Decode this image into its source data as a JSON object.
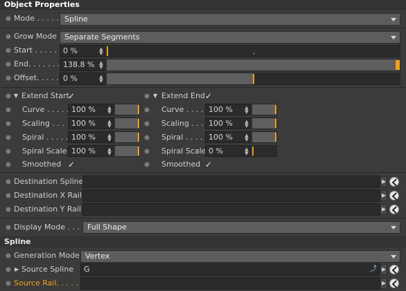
{
  "header": {
    "title": "Object Properties"
  },
  "mode": {
    "label": "Mode . . . . .",
    "value": "Spline"
  },
  "grow_mode": {
    "label": "Grow Mode",
    "value": "Separate Segments"
  },
  "start": {
    "label": "Start . . . . . .",
    "value": "0 %",
    "level": 0
  },
  "end": {
    "label": "End. . . . . . .",
    "value": "138.8 %",
    "level": 1.0
  },
  "offset": {
    "label": "Offset. . . . .",
    "value": "0 %",
    "level": 0.5
  },
  "extend_start": {
    "label": "Extend Start",
    "check": "✓"
  },
  "extend_end": {
    "label": "Extend End",
    "check": "✓"
  },
  "left_group": {
    "curve": {
      "label": "Curve . . . . .",
      "value": "100 %",
      "level": 1.0
    },
    "scaling": {
      "label": "Scaling . . . .",
      "value": "100 %",
      "level": 1.0
    },
    "spiral": {
      "label": "Spiral . . . . .",
      "value": "100 %",
      "level": 1.0
    },
    "spiral_scale": {
      "label": "Spiral Scale",
      "value": "100 %",
      "level": 1.0
    },
    "smoothed": {
      "label": "Smoothed",
      "check": "✓"
    }
  },
  "right_group": {
    "curve": {
      "label": "Curve . . . . .",
      "value": "100 %",
      "level": 1.0
    },
    "scaling": {
      "label": "Scaling . . . .",
      "value": "100 %",
      "level": 1.0
    },
    "spiral": {
      "label": "Spiral . . . . .",
      "value": "100 %",
      "level": 1.0
    },
    "spiral_scale": {
      "label": "Spiral Scale",
      "value": "0 %",
      "level": 0
    },
    "smoothed": {
      "label": "Smoothed",
      "check": "✓"
    }
  },
  "destination_spline": {
    "label": "Destination Spline",
    "value": ""
  },
  "destination_x_rail": {
    "label": "Destination X Rail",
    "value": ""
  },
  "destination_y_rail": {
    "label": "Destination Y Rail",
    "value": ""
  },
  "display_mode": {
    "label": "Display Mode . . .",
    "value": "Full Shape"
  },
  "spline_section": {
    "title": "Spline"
  },
  "generation_mode": {
    "label": "Generation Mode",
    "value": "Vertex"
  },
  "source_spline": {
    "label": "Source Spline",
    "value": "G"
  },
  "source_rail": {
    "label": "Source Rail. . . . . .",
    "value": ""
  },
  "colors": {
    "accent": "#f0a21c",
    "background": "#3b3b3b",
    "field": "#2b2b2b"
  }
}
